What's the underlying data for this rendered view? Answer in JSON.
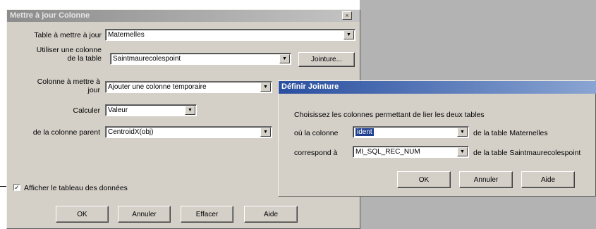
{
  "main_dialog": {
    "title": "Mettre à jour Colonne",
    "close_glyph": "×",
    "table_label": "Table à mettre à jour",
    "table_value": "Maternelles",
    "use_column_label_1": "Utiliser une colonne",
    "use_column_label_2": "de la table",
    "use_column_value": "Saintmaurecolespoint",
    "join_button": "Jointure...",
    "column_label_1": "Colonne à mettre à",
    "column_label_2": "jour",
    "column_value": "Ajouter une colonne temporaire",
    "calculate_label": "Calculer",
    "calculate_value": "Valeur",
    "source_column_label": "de la colonne parent",
    "source_column_value": "CentroidX(obj)",
    "show_table_label": "Afficher le tableau des données",
    "show_table_checked": "✓",
    "ok_button": "OK",
    "cancel_button": "Annuler",
    "clear_button": "Effacer",
    "help_button": "Aide"
  },
  "join_dialog": {
    "title": "Définir Jointure",
    "instructions": "Choisissez les colonnes permettant de lier les deux tables",
    "where_column_label": "où la colonne",
    "where_column_value": "ident",
    "of_table_1": "de la table Maternelles",
    "corresponds_label": "correspond à",
    "corresponds_value": "MI_SQL_REC_NUM",
    "of_table_2": "de la table Saintmaurecolespoint",
    "ok_button": "OK",
    "cancel_button": "Annuler",
    "help_button": "Aide"
  },
  "icons": {
    "dropdown": "▼"
  }
}
